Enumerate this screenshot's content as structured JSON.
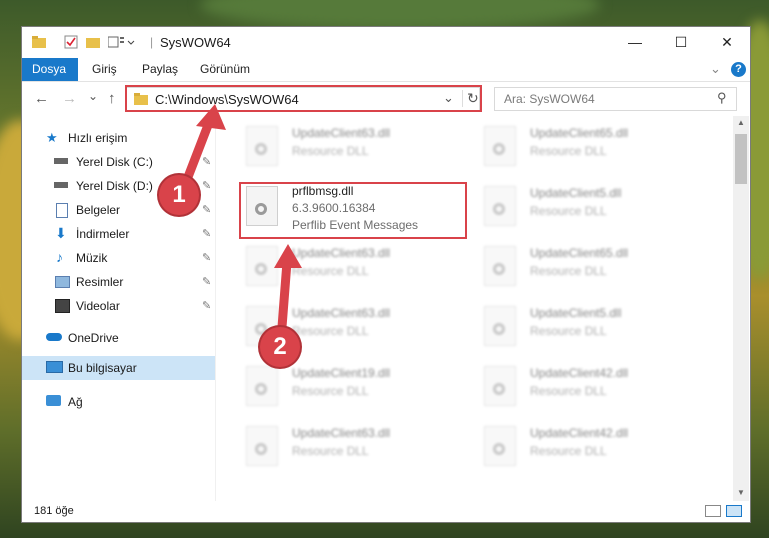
{
  "window": {
    "title": "SysWOW64",
    "minimize_glyph": "—",
    "maximize_glyph": "☐",
    "close_glyph": "✕"
  },
  "ribbon": {
    "tabs": [
      {
        "label": "Dosya",
        "active": true
      },
      {
        "label": "Giriş"
      },
      {
        "label": "Paylaş"
      },
      {
        "label": "Görünüm"
      }
    ],
    "help_glyph": "?",
    "expand_glyph": "⌄"
  },
  "nav": {
    "back_glyph": "←",
    "forward_glyph": "→",
    "recent_glyph": "⌄",
    "up_glyph": "↑",
    "address": "C:\\Windows\\SysWOW64",
    "address_dropdown_glyph": "⌄",
    "refresh_glyph": "↻",
    "search_placeholder": "Ara: SysWOW64",
    "search_glyph": "⚲"
  },
  "sidebar": {
    "quick_access": "Hızlı erişim",
    "items": [
      {
        "label": "Yerel Disk (C:)",
        "icon": "drive-icon"
      },
      {
        "label": "Yerel Disk (D:)",
        "icon": "drive-icon"
      },
      {
        "label": "Belgeler",
        "icon": "documents-icon"
      },
      {
        "label": "İndirmeler",
        "icon": "downloads-icon"
      },
      {
        "label": "Müzik",
        "icon": "music-icon"
      },
      {
        "label": "Resimler",
        "icon": "pictures-icon"
      },
      {
        "label": "Videolar",
        "icon": "videos-icon"
      }
    ],
    "onedrive": "OneDrive",
    "this_pc": "Bu bilgisayar",
    "network": "Ağ",
    "pin_glyph": "📌"
  },
  "files": {
    "highlighted": {
      "name": "prflbmsg.dll",
      "version": "6.3.9600.16384",
      "description": "Perflib Event Messages"
    },
    "blurred": [
      {
        "name": "UpdateClient63.dll",
        "sub": "Resource DLL"
      },
      {
        "name": "UpdateClient65.dll",
        "sub": "Resource DLL"
      },
      {
        "name": "UpdateClient5.dll",
        "sub": "Resource DLL"
      },
      {
        "name": "UpdateClient63.dll",
        "sub": "Resource DLL"
      },
      {
        "name": "UpdateClient65.dll",
        "sub": "Resource DLL"
      },
      {
        "name": "UpdateClient63.dll",
        "sub": "Resource DLL"
      },
      {
        "name": "UpdateClient5.dll",
        "sub": "Resource DLL"
      },
      {
        "name": "UpdateClient19.dll",
        "sub": "Resource DLL"
      },
      {
        "name": "UpdateClient42.dll",
        "sub": "Resource DLL"
      },
      {
        "name": "UpdateClient63.dll",
        "sub": "Resource DLL"
      },
      {
        "name": "UpdateClient42.dll",
        "sub": "Resource DLL"
      }
    ]
  },
  "status": {
    "count": "181 öğe"
  },
  "annotations": {
    "step1": "1",
    "step2": "2"
  },
  "colors": {
    "accent": "#1979ca",
    "highlight": "#d9434a",
    "selected": "#cce4f7"
  }
}
